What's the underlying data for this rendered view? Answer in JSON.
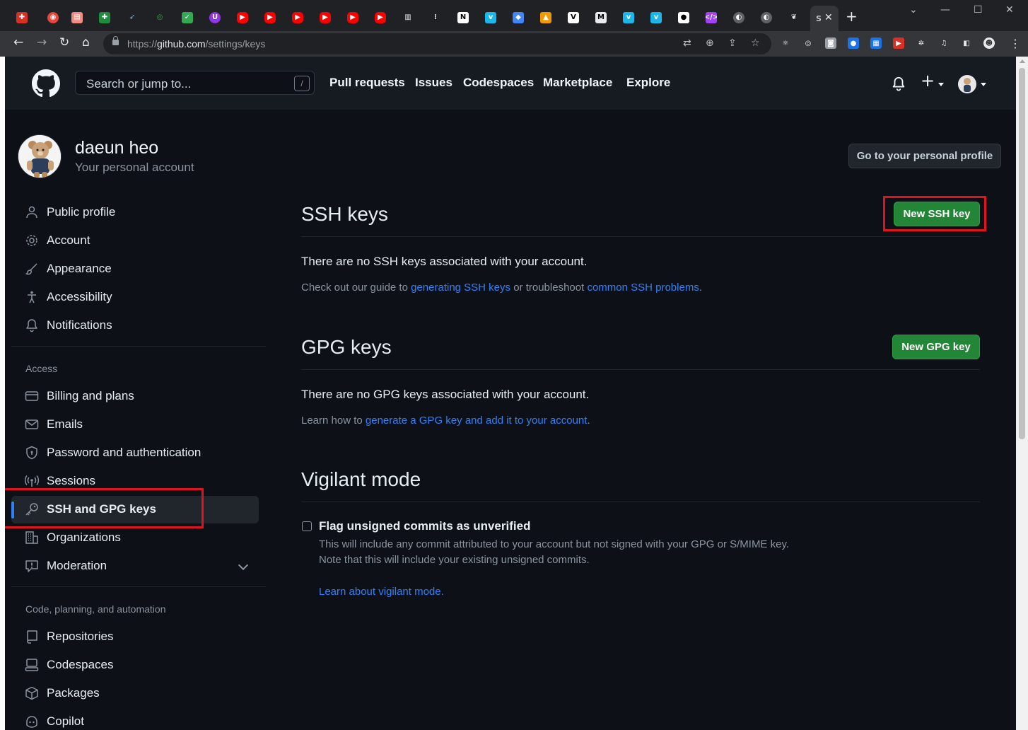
{
  "browser": {
    "url_scheme": "https://",
    "url_host": "github.com",
    "url_path": "/settings/keys",
    "active_tab_letter": "S",
    "tab_icons": [
      "gift",
      "sync",
      "note",
      "grid",
      "bird",
      "whatsapp",
      "check",
      "ublock",
      "youtube",
      "youtube",
      "youtube",
      "youtube",
      "youtube",
      "youtube",
      "book",
      "dots",
      "notion",
      "vimeo",
      "maps",
      "gcp",
      "va",
      "m",
      "vimeo",
      "vimeo",
      "medium",
      "code",
      "globe",
      "globe",
      "leaf"
    ]
  },
  "header": {
    "search_placeholder": "Search or jump to...",
    "search_shortcut": "/",
    "nav": [
      "Pull requests",
      "Issues",
      "Codespaces",
      "Marketplace",
      "Explore"
    ]
  },
  "account": {
    "name": "daeun heo",
    "subtitle": "Your personal account",
    "profile_button": "Go to your personal profile"
  },
  "sidebar": {
    "items": [
      {
        "label": "Public profile",
        "icon": "person-icon"
      },
      {
        "label": "Account",
        "icon": "gear-icon"
      },
      {
        "label": "Appearance",
        "icon": "paintbrush-icon"
      },
      {
        "label": "Accessibility",
        "icon": "accessibility-icon"
      },
      {
        "label": "Notifications",
        "icon": "bell-icon"
      }
    ],
    "access_heading": "Access",
    "access_items": [
      {
        "label": "Billing and plans",
        "icon": "credit-card-icon"
      },
      {
        "label": "Emails",
        "icon": "mail-icon"
      },
      {
        "label": "Password and authentication",
        "icon": "shield-lock-icon"
      },
      {
        "label": "Sessions",
        "icon": "broadcast-icon"
      },
      {
        "label": "SSH and GPG keys",
        "icon": "key-icon",
        "active": true
      },
      {
        "label": "Organizations",
        "icon": "organization-icon"
      },
      {
        "label": "Moderation",
        "icon": "report-icon"
      }
    ],
    "code_heading": "Code, planning, and automation",
    "code_items": [
      {
        "label": "Repositories",
        "icon": "repo-icon"
      },
      {
        "label": "Codespaces",
        "icon": "codespaces-icon"
      },
      {
        "label": "Packages",
        "icon": "package-icon"
      },
      {
        "label": "Copilot",
        "icon": "copilot-icon"
      }
    ]
  },
  "ssh": {
    "title": "SSH keys",
    "button": "New SSH key",
    "empty": "There are no SSH keys associated with your account.",
    "guide_prefix": "Check out our guide to ",
    "guide_link": "generating SSH keys",
    "guide_middle": " or troubleshoot ",
    "guide_link2": "common SSH problems",
    "guide_suffix": "."
  },
  "gpg": {
    "title": "GPG keys",
    "button": "New GPG key",
    "empty": "There are no GPG keys associated with your account.",
    "learn_prefix": "Learn how to ",
    "learn_link": "generate a GPG key and add it to your account",
    "learn_suffix": "."
  },
  "vigilant": {
    "title": "Vigilant mode",
    "checkbox_label": "Flag unsigned commits as unverified",
    "checked": false,
    "desc1": "This will include any commit attributed to your account but not signed with your GPG or S/MIME key.",
    "desc2": "Note that this will include your existing unsigned commits.",
    "link": "Learn about vigilant mode",
    "link_suffix": "."
  },
  "colors": {
    "page_bg": "#0d1117",
    "header_bg": "#161b22",
    "accent_blue": "#2f81f7",
    "button_green": "#238636",
    "highlight_red": "#e0141e"
  }
}
